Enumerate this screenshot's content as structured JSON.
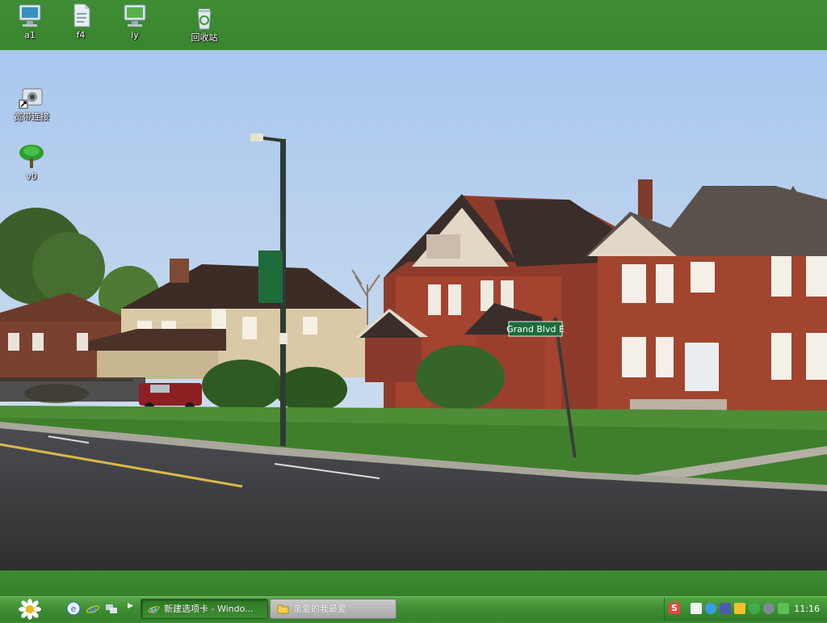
{
  "desktop": {
    "top_icons": [
      {
        "label": "a1",
        "icon": "monitor-icon"
      },
      {
        "label": "f4",
        "icon": "document-icon"
      },
      {
        "label": "ly",
        "icon": "monitor-icon"
      },
      {
        "label": "回收站",
        "icon": "recycle-bin-icon"
      }
    ],
    "left_icons": [
      {
        "label": "宽带连接",
        "icon": "broadband-connection-icon"
      },
      {
        "label": "v0",
        "icon": "tree-icon"
      }
    ],
    "wallpaper": {
      "street_sign": "Grand Blvd E",
      "colors": {
        "sky": "#b9d2ef",
        "grass": "#3f7f2c",
        "road": "#3a3a3c",
        "band": "#3e8a32"
      }
    }
  },
  "taskbar": {
    "start_icon": "daisy-start-icon",
    "quick_launch": [
      "desktop-icon",
      "ie-icon",
      "network-icon"
    ],
    "tasks": [
      {
        "label": "新建选项卡 - Windo...",
        "icon": "ie-icon",
        "active": true
      },
      {
        "label": "亲爱的我最爱",
        "icon": "folder-icon",
        "active": false
      }
    ],
    "tray_icons": [
      "sogou-input-icon",
      "keyboard-icon",
      "kaspersky-icon",
      "network-icon",
      "alert-icon",
      "360-icon",
      "sound-icon",
      "security-shield-icon"
    ],
    "clock": "11:16"
  }
}
